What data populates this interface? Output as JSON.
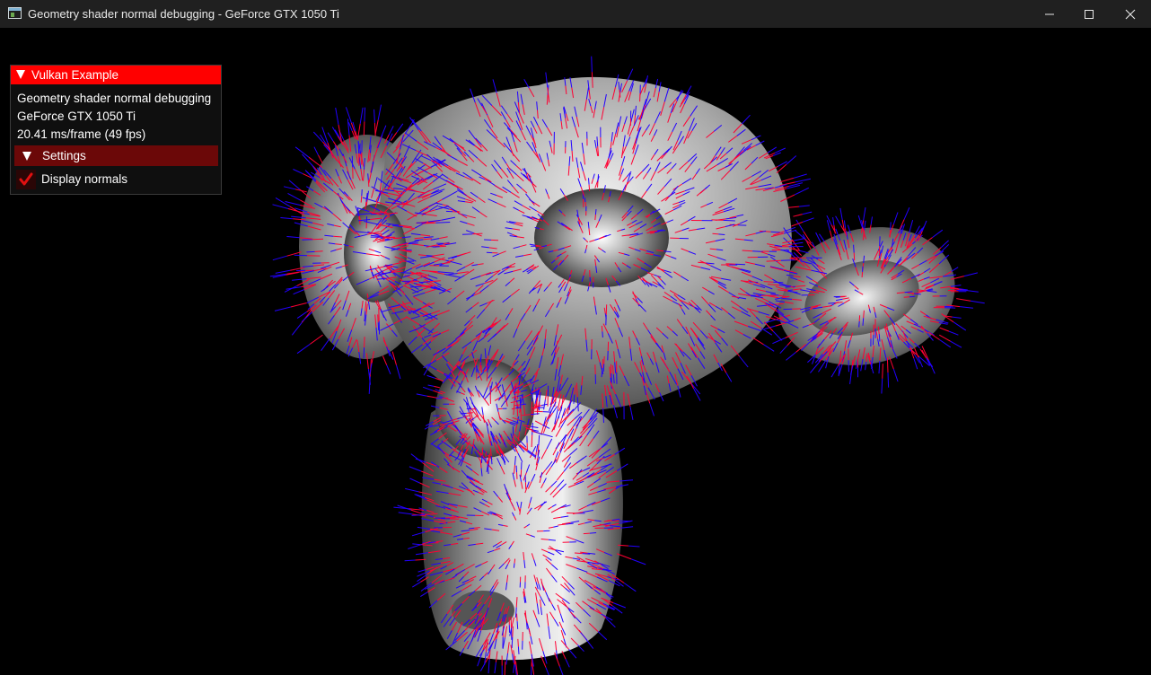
{
  "window": {
    "title": "Geometry shader normal debugging - GeForce GTX 1050 Ti",
    "icon": "app-window-icon",
    "controls": [
      "minimize-icon",
      "maximize-icon",
      "close-icon"
    ]
  },
  "overlay": {
    "header_label": "Vulkan Example",
    "app_name": "Geometry shader normal debugging",
    "device_name": "GeForce GTX 1050 Ti",
    "frame_stats": "20.41 ms/frame (49 fps)",
    "settings": {
      "label": "Settings",
      "display_normals": {
        "label": "Display normals",
        "checked": true
      }
    }
  },
  "colors": {
    "titlebar": "#202020",
    "header_accent": "#ff0000",
    "settings_header": "#6b0808",
    "checkmark": "#e01010",
    "normal_base": "#ff0033",
    "normal_tip": "#2200ff",
    "background": "#000000"
  }
}
